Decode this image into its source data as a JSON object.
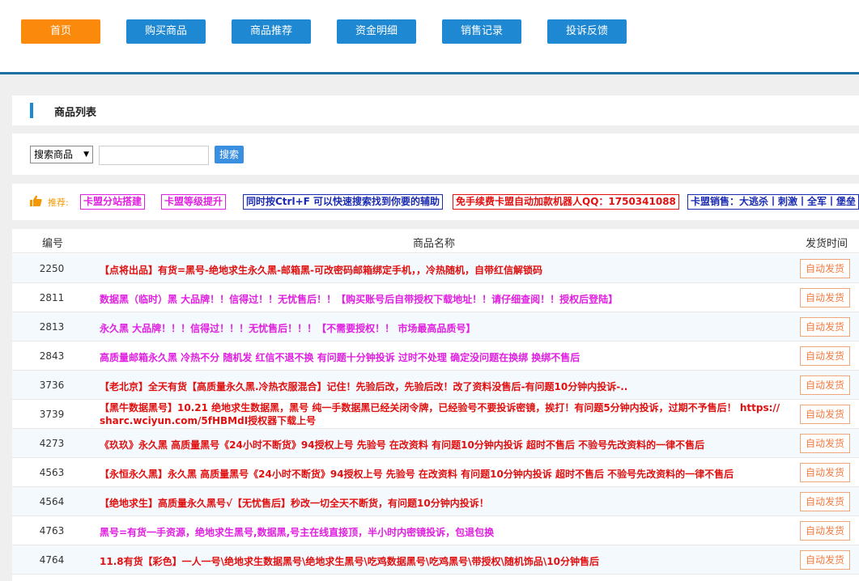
{
  "nav": {
    "items": [
      {
        "label": "首页",
        "active": true
      },
      {
        "label": "购买商品",
        "active": false
      },
      {
        "label": "商品推荐",
        "active": false
      },
      {
        "label": "资金明细",
        "active": false
      },
      {
        "label": "销售记录",
        "active": false
      },
      {
        "label": "投诉反馈",
        "active": false
      }
    ]
  },
  "section": {
    "title": "商品列表"
  },
  "search": {
    "select_value": "搜索商品",
    "input_value": "",
    "button_label": "搜索"
  },
  "recommend": {
    "label": "推荐:",
    "tags": [
      {
        "text": "卡盟分站搭建",
        "color": "#e020e0"
      },
      {
        "text": "卡盟等级提升",
        "color": "#e020e0"
      },
      {
        "text": "同时按Ctrl+F 可以快速搜索找到你要的辅助",
        "color": "#1a2ab0"
      },
      {
        "text": "免手续费卡盟自动加款机器人QQ：1750341088",
        "color": "#e01010"
      },
      {
        "text": "卡盟销售：大逃杀丨刺激丨全军丨堡垒",
        "color": "#1a2ab0"
      }
    ]
  },
  "table": {
    "headers": {
      "id": "编号",
      "name": "商品名称",
      "time": "发货时间"
    },
    "rows": [
      {
        "id": "2250",
        "name": "【点将出品】有货=黑号-绝地求生永久黑-邮箱黑-可改密码邮箱绑定手机，，冷热随机，自带红信解锁码",
        "color": "#e01010",
        "status": "自动发货"
      },
      {
        "id": "2811",
        "name": "数据黑（临时）黑 大品牌！！信得过！！无忧售后！！【购买账号后自带授权下载地址！！请仔细查阅！！授权后登陆】",
        "color": "#e020e0",
        "status": "自动发货"
      },
      {
        "id": "2813",
        "name": "永久黑 大品牌！！！信得过！！！无忧售后！！！【不需要授权！！ 市场最高品质号】",
        "color": "#e020e0",
        "status": "自动发货"
      },
      {
        "id": "2843",
        "name": "高质量邮箱永久黑 冷热不分 随机发 红信不退不换 有问题十分钟投诉 过时不处理 确定没问题在换绑 换绑不售后",
        "color": "#e020e0",
        "status": "自动发货"
      },
      {
        "id": "3736",
        "name": "【老北京】全天有货【高质量永久黑.冷热衣服混合】记住！先验后改，先验后改！改了资料没售后-有问题10分钟内投诉-..",
        "color": "#e01010",
        "status": "自动发货"
      },
      {
        "id": "3739",
        "name": "【黑牛数据黑号】10.21 绝地求生数据黑，黑号 纯一手数据黑已经关闭令牌，已经验号不要投诉密镜，挨打！有问题5分钟内投诉，过期不予售后！ https://sharc.wciyun.com/5fHBMdI授权器下载上号",
        "color": "#e01010",
        "status": "自动发货",
        "wrap": true
      },
      {
        "id": "4273",
        "name": "《玖玖》永久黑 高质量黑号《24小时不断货》94授权上号 先验号 在改资料 有问题10分钟内投诉 超时不售后 不验号先改资料的一律不售后",
        "color": "#e01010",
        "status": "自动发货"
      },
      {
        "id": "4563",
        "name": "【永恒永久黑】永久黑 高质量黑号《24小时不断货》94授权上号 先验号 在改资料 有问题10分钟内投诉 超时不售后 不验号先改资料的一律不售后",
        "color": "#e01010",
        "status": "自动发货"
      },
      {
        "id": "4564",
        "name": "【绝地求生】高质量永久黑号√【无忧售后】秒改一切全天不断货，有问题10分钟内投诉！",
        "color": "#e01010",
        "status": "自动发货"
      },
      {
        "id": "4763",
        "name": "黑号=有货一手资源，绝地求生黑号,数据黑,号主在线直接顶，半小时内密镜投诉，包退包换",
        "color": "#e020e0",
        "status": "自动发货"
      },
      {
        "id": "4764",
        "name": "11.8有货【彩色】一人一号\\绝地求生数据黑号\\绝地求生黑号\\吃鸡数据黑号\\吃鸡黑号\\带授权\\随机饰品\\10分钟售后",
        "color": "#e01010",
        "status": "自动发货"
      }
    ]
  }
}
